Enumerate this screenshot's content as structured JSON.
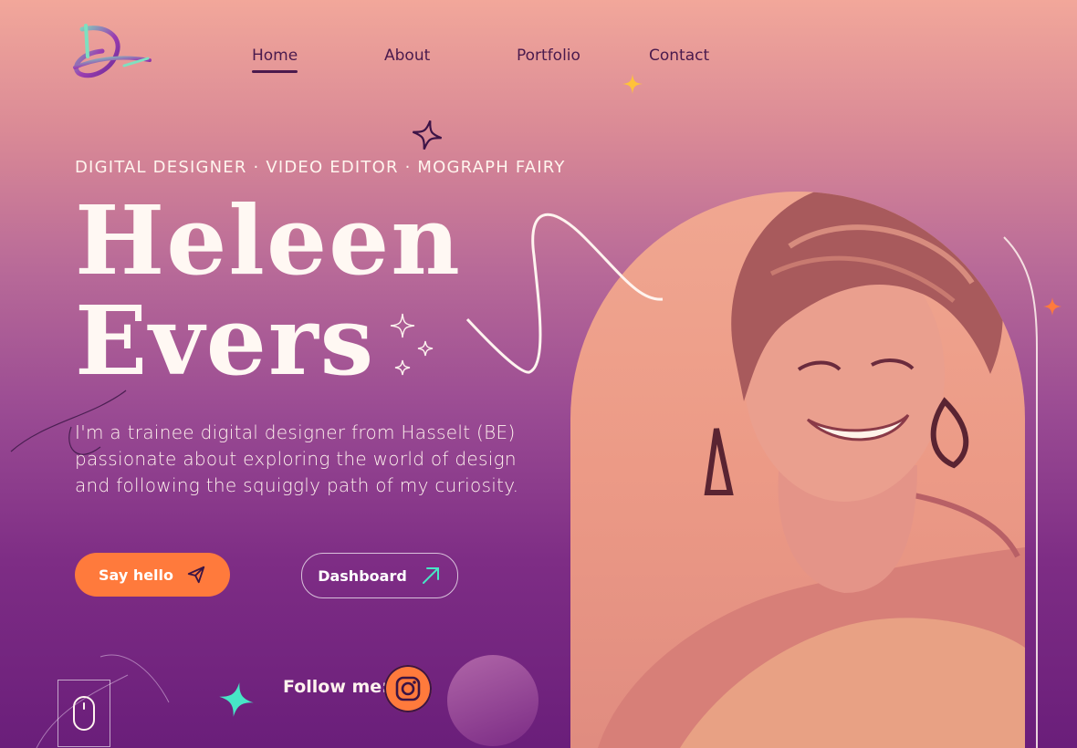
{
  "nav": {
    "items": [
      {
        "label": "Home",
        "active": true
      },
      {
        "label": "About",
        "active": false
      },
      {
        "label": "Portfolio",
        "active": false
      },
      {
        "label": "Contact",
        "active": false
      }
    ]
  },
  "hero": {
    "tagline": "DIGITAL DESIGNER · VIDEO EDITOR · MOGRAPH FAIRY",
    "name_line1": "Heleen",
    "name_line2": "Evers",
    "intro_line1": "I'm a trainee digital designer from Hasselt (BE)",
    "intro_line2": "passionate about exploring the world of design",
    "intro_line3": "and following the squiggly path of my curiosity."
  },
  "buttons": {
    "say_hello": "Say hello",
    "dashboard": "Dashboard"
  },
  "social": {
    "follow_label": "Follow me:",
    "icon": "instagram-icon"
  },
  "colors": {
    "accent_orange": "#ff7a3c",
    "nav_text": "#4a1a4d",
    "teal_star": "#47e6c6",
    "yellow_star": "#ffc23a"
  }
}
